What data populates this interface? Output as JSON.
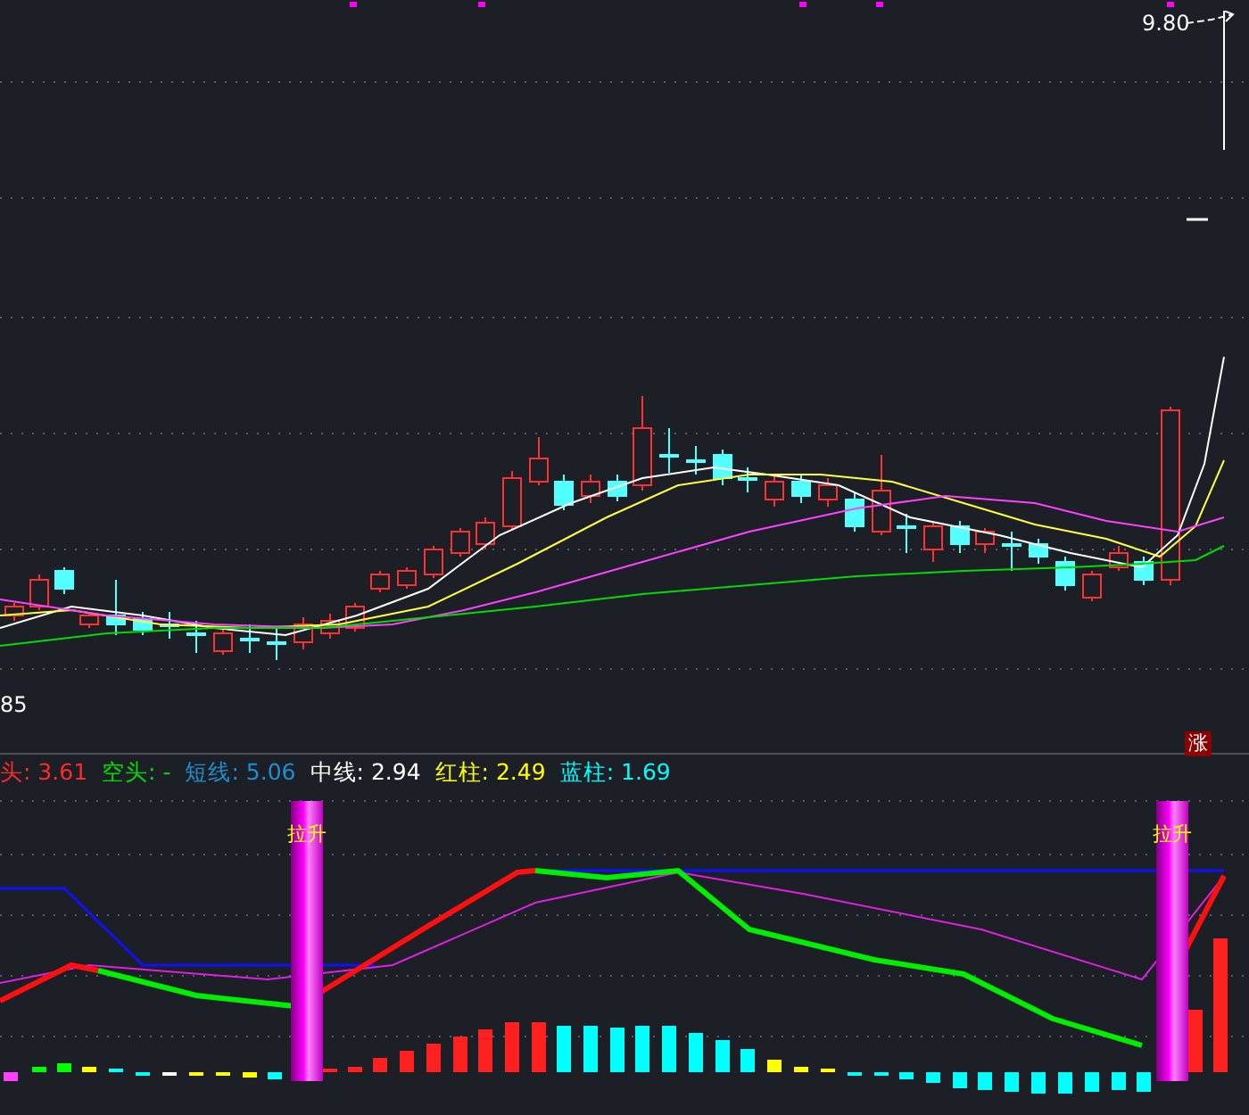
{
  "price_panel": {
    "high_label": "9.80",
    "low_label": "85",
    "badge": "涨"
  },
  "indicator_panel": {
    "legend": [
      {
        "text": "头: 3.61",
        "color": "#ff2a2a"
      },
      {
        "text": "空头: -",
        "color": "#00e000"
      },
      {
        "text": "短线: 5.06",
        "color": "#1e8fd0"
      },
      {
        "text": "中线: 2.94",
        "color": "#ffffff"
      },
      {
        "text": "红柱: 2.49",
        "color": "#ffff00"
      },
      {
        "text": "蓝柱: 1.69",
        "color": "#00ffff"
      }
    ],
    "signals": [
      {
        "label": "拉升"
      },
      {
        "label": "拉升"
      }
    ]
  }
}
